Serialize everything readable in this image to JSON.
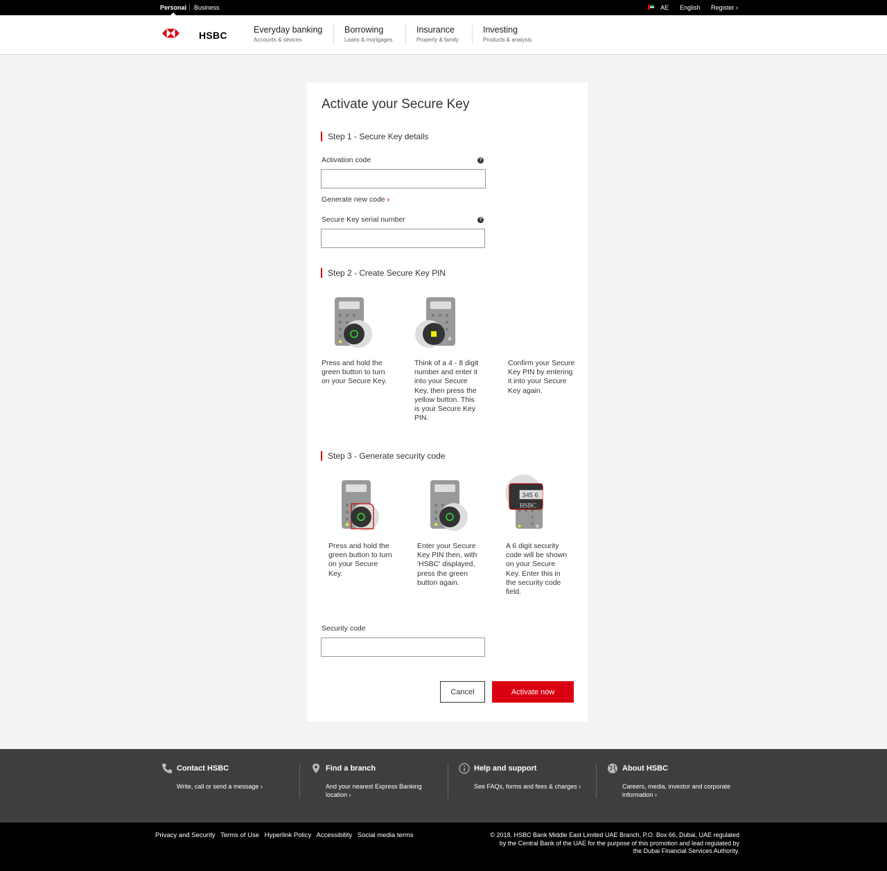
{
  "topbar": {
    "personal": "Personal",
    "business": "Business",
    "country": "AE",
    "language": "English",
    "register": "Register"
  },
  "header": {
    "logo_text": "HSBC",
    "nav": [
      {
        "label": "Everyday banking",
        "sub": "Accounts & sevices"
      },
      {
        "label": "Borrowing",
        "sub": "Loans & mortgages"
      },
      {
        "label": "Insurance",
        "sub": "Property & family"
      },
      {
        "label": "Investing",
        "sub": "Products & analysis"
      }
    ]
  },
  "form": {
    "title": "Activate your Secure Key",
    "step1": {
      "heading": "Step 1 - Secure Key details",
      "activation_label": "Activation code",
      "activation_value": "",
      "generate_link": "Generate new code",
      "serial_label": "Secure Key serial number",
      "serial_value": ""
    },
    "step2": {
      "heading": "Step 2 - Create Secure Key PIN",
      "instructions": [
        "Press and hold the green button to turn on your Secure Key.",
        "Think of a 4 - 8 digit number and enter it into your Secure Key, then press the yellow button. This is your Secure Key PIN.",
        "Confirm your Secure Key PIN by entering it into your Secure Key again."
      ]
    },
    "step3": {
      "heading": "Step 3 - Generate security code",
      "instructions": [
        "Press and hold the green button to turn on your Secure Key.",
        "Enter your Secure Key PIN then, with 'HSBC' displayed, press the green button again.",
        "A 6 digit security code will be shown on your Secure Key. Enter this in the security code field."
      ],
      "screen_code": "345 6",
      "screen_text": "HSBC"
    },
    "security_label": "Security code",
    "security_value": "",
    "cancel": "Cancel",
    "activate": "Activate now"
  },
  "footer": {
    "columns": [
      {
        "icon": "phone-icon",
        "title": "Contact HSBC",
        "desc": "Write, call or send a message"
      },
      {
        "icon": "location-pin-icon",
        "title": "Find a branch",
        "desc": "And your nearest Express Banking location"
      },
      {
        "icon": "info-icon",
        "title": "Help and support",
        "desc": "See FAQs, forms and fees & charges"
      },
      {
        "icon": "globe-icon",
        "title": "About HSBC",
        "desc": "Careers, media, investor and corporate information"
      }
    ],
    "links": [
      "Privacy and Security",
      "Terms of Use",
      "Hyperlink Policy",
      "Accessibility",
      "Social media terms"
    ],
    "copyright": "© 2018. HSBC Bank Middle East Limited UAE Branch, P.O. Box 66, Dubai, UAE regulated by the Central Bank of the UAE for the purpose of this promotion and lead regulated by the Dubai Financial Services Authority."
  },
  "colors": {
    "brand_red": "#db0011",
    "dark_footer": "#3e3e3e",
    "black": "#000000"
  }
}
